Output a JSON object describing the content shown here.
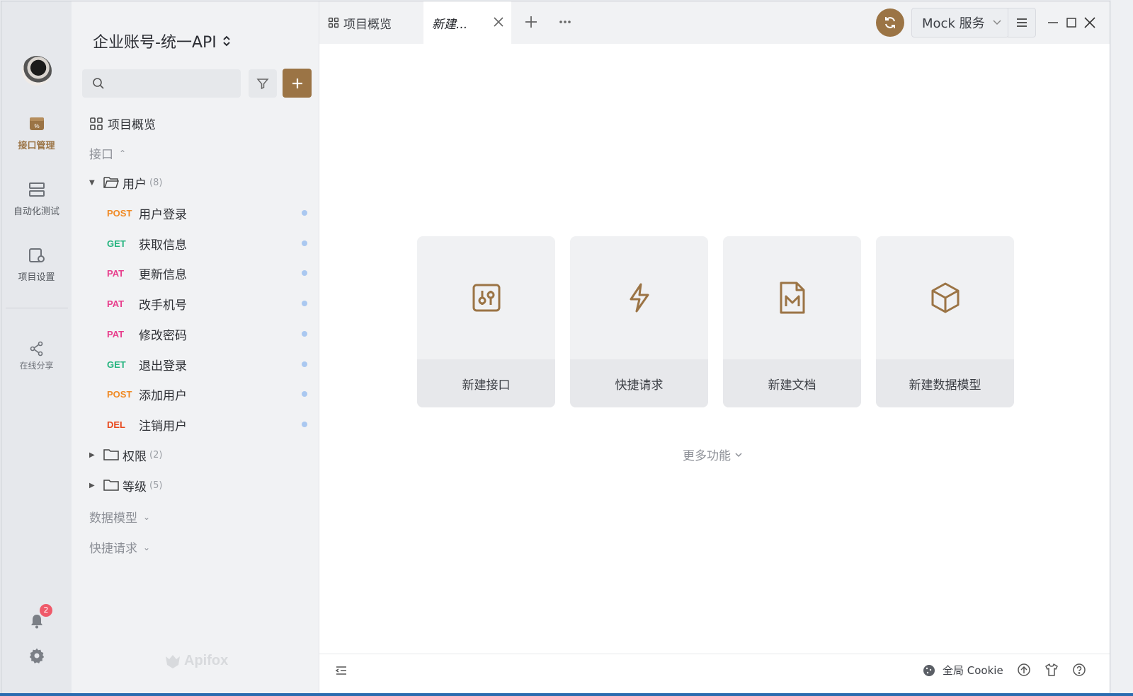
{
  "rail": {
    "items": [
      {
        "label": "接口管理",
        "icon": "api-manage-icon"
      },
      {
        "label": "自动化测试",
        "icon": "server-icon"
      },
      {
        "label": "项目设置",
        "icon": "project-settings-icon"
      }
    ],
    "share_label": "在线分享",
    "notification_count": "2"
  },
  "sidebar": {
    "project_name": "企业账号-统一API",
    "search_placeholder": "",
    "overview_label": "项目概览",
    "api_section": "接口",
    "folders": [
      {
        "name": "用户",
        "count": "(8)",
        "expanded": true
      },
      {
        "name": "权限",
        "count": "(2)",
        "expanded": false
      },
      {
        "name": "等级",
        "count": "(5)",
        "expanded": false
      }
    ],
    "apis": [
      {
        "method": "POST",
        "name": "用户登录",
        "color": "#f08a24"
      },
      {
        "method": "GET",
        "name": "获取信息",
        "color": "#26b47f"
      },
      {
        "method": "PAT",
        "name": "更新信息",
        "color": "#e83e8c"
      },
      {
        "method": "PAT",
        "name": "改手机号",
        "color": "#e83e8c"
      },
      {
        "method": "PAT",
        "name": "修改密码",
        "color": "#e83e8c"
      },
      {
        "method": "GET",
        "name": "退出登录",
        "color": "#26b47f"
      },
      {
        "method": "POST",
        "name": "添加用户",
        "color": "#f08a24"
      },
      {
        "method": "DEL",
        "name": "注销用户",
        "color": "#e8481c"
      }
    ],
    "data_model_section": "数据模型",
    "quick_request_section": "快捷请求",
    "watermark": "Apifox"
  },
  "tabs": {
    "overview_label": "项目概览",
    "active_label": "新建..."
  },
  "toolbar": {
    "mock_label": "Mock 服务"
  },
  "main": {
    "cards": [
      {
        "label": "新建接口",
        "icon": "api-icon"
      },
      {
        "label": "快捷请求",
        "icon": "lightning-icon"
      },
      {
        "label": "新建文档",
        "icon": "markdown-doc-icon"
      },
      {
        "label": "新建数据模型",
        "icon": "cube-icon"
      }
    ],
    "more_label": "更多功能"
  },
  "statusbar": {
    "cookie_label": "全局 Cookie"
  },
  "colors": {
    "accent": "#9b7445"
  }
}
